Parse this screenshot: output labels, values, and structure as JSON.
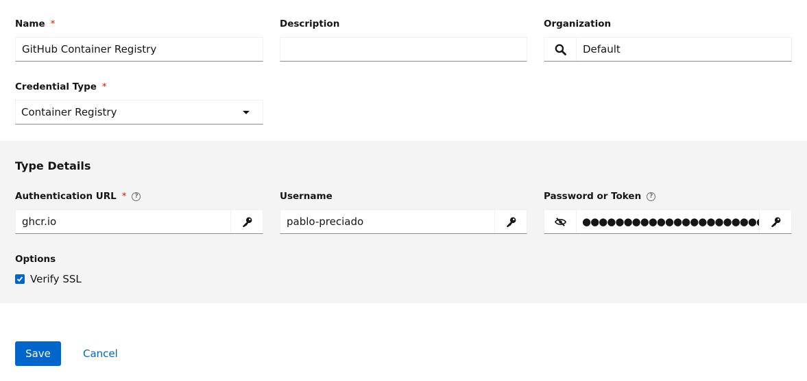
{
  "form": {
    "name": {
      "label": "Name",
      "required_mark": "*",
      "value": "GitHub Container Registry"
    },
    "description": {
      "label": "Description",
      "value": ""
    },
    "organization": {
      "label": "Organization",
      "value": "Default",
      "icon": "search-icon"
    },
    "credential_type": {
      "label": "Credential Type",
      "required_mark": "*",
      "value": "Container Registry"
    }
  },
  "type_details": {
    "title": "Type Details",
    "auth_url": {
      "label": "Authentication URL",
      "required_mark": "*",
      "value": "ghcr.io",
      "help": "?"
    },
    "username": {
      "label": "Username",
      "value": "pablo-preciado"
    },
    "password": {
      "label": "Password or Token",
      "value": "●●●●●●●●●●●●●●●●●●●●●●●●●●●",
      "help": "?"
    },
    "options": {
      "label": "Options",
      "verify_ssl": {
        "label": "Verify SSL",
        "checked": true
      }
    }
  },
  "actions": {
    "save_label": "Save",
    "cancel_label": "Cancel"
  },
  "colors": {
    "primary": "#0066cc",
    "required": "#c9190b",
    "section_bg": "#f4f4f4"
  }
}
